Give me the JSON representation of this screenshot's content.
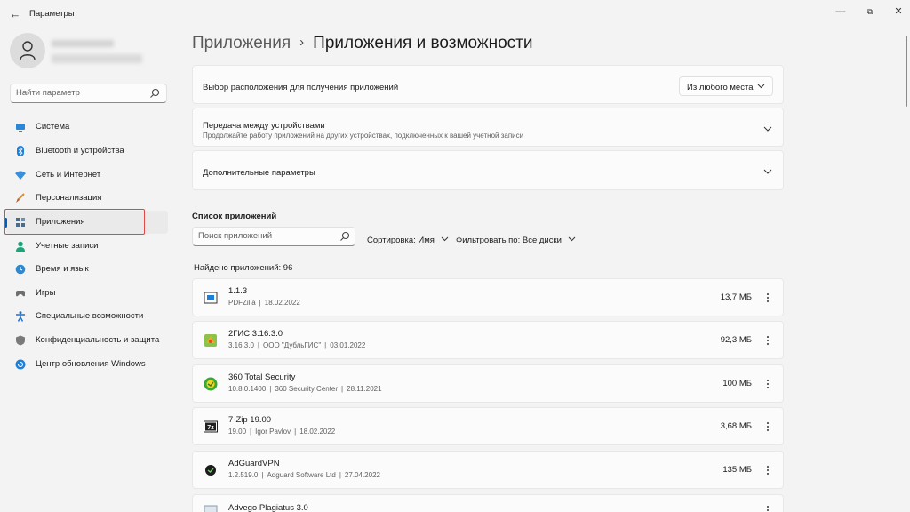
{
  "window": {
    "title": "Параметры",
    "back_glyph": "←",
    "min_glyph": "—",
    "max_glyph": "⧉",
    "close_glyph": "✕"
  },
  "sidebar": {
    "search_placeholder": "Найти параметр",
    "items": [
      {
        "label": "Система",
        "icon": "monitor-icon",
        "color": "#2b88d8"
      },
      {
        "label": "Bluetooth и устройства",
        "icon": "bluetooth-icon",
        "color": "#1e7fd8"
      },
      {
        "label": "Сеть и Интернет",
        "icon": "wifi-icon",
        "color": "#3a8fd8"
      },
      {
        "label": "Персонализация",
        "icon": "brush-icon",
        "color": "#e08a2e"
      },
      {
        "label": "Приложения",
        "icon": "apps-icon",
        "color": "#4b6b8c",
        "selected": true
      },
      {
        "label": "Учетные записи",
        "icon": "person-icon",
        "color": "#22a27a"
      },
      {
        "label": "Время и язык",
        "icon": "globe-clock-icon",
        "color": "#2e88d0"
      },
      {
        "label": "Игры",
        "icon": "gamepad-icon",
        "color": "#6e6e6e"
      },
      {
        "label": "Специальные возможности",
        "icon": "accessibility-icon",
        "color": "#1e6fc8"
      },
      {
        "label": "Конфиденциальность и защита",
        "icon": "shield-icon",
        "color": "#7a7a7a"
      },
      {
        "label": "Центр обновления Windows",
        "icon": "update-icon",
        "color": "#1e7fd8"
      }
    ]
  },
  "breadcrumb": {
    "parent": "Приложения",
    "separator": "›",
    "current": "Приложения и возможности"
  },
  "settings_cards": {
    "source": {
      "title": "Выбор расположения для получения приложений",
      "dropdown_value": "Из любого места"
    },
    "share": {
      "title": "Передача между устройствами",
      "subtitle": "Продолжайте работу приложений на других устройствах, подключенных к вашей учетной записи"
    },
    "advanced": {
      "title": "Дополнительные параметры"
    }
  },
  "app_list": {
    "title": "Список приложений",
    "search_placeholder": "Поиск приложений",
    "sort_label": "Сортировка:",
    "sort_value": "Имя",
    "filter_label": "Фильтровать по:",
    "filter_value": "Все диски",
    "found": "Найдено приложений: 96",
    "apps": [
      {
        "name": "1.1.3",
        "publisher": "PDFZilla",
        "version": "",
        "date": "18.02.2022",
        "size": "13,7 МБ",
        "icon": "pdfzilla-icon"
      },
      {
        "name": "2ГИС 3.16.3.0",
        "version": "3.16.3.0",
        "publisher": "ООО \"ДубльГИС\"",
        "date": "03.01.2022",
        "size": "92,3 МБ",
        "icon": "2gis-icon"
      },
      {
        "name": "360 Total Security",
        "version": "10.8.0.1400",
        "publisher": "360 Security Center",
        "date": "28.11.2021",
        "size": "100 МБ",
        "icon": "360-security-icon"
      },
      {
        "name": "7-Zip 19.00",
        "version": "19.00",
        "publisher": "Igor Pavlov",
        "date": "18.02.2022",
        "size": "3,68 МБ",
        "icon": "7zip-icon"
      },
      {
        "name": "AdGuardVPN",
        "version": "1.2.519.0",
        "publisher": "Adguard Software Ltd",
        "date": "27.04.2022",
        "size": "135 МБ",
        "icon": "adguard-vpn-icon"
      },
      {
        "name": "Advego Plagiatus 3.0",
        "version": "",
        "publisher": "",
        "date": "",
        "size": "",
        "icon": "advego-icon"
      }
    ]
  },
  "colors": {
    "accent": "#005fb8",
    "highlight_outline": "#e04848",
    "background": "#f3f3f3",
    "card": "#fbfbfb"
  }
}
